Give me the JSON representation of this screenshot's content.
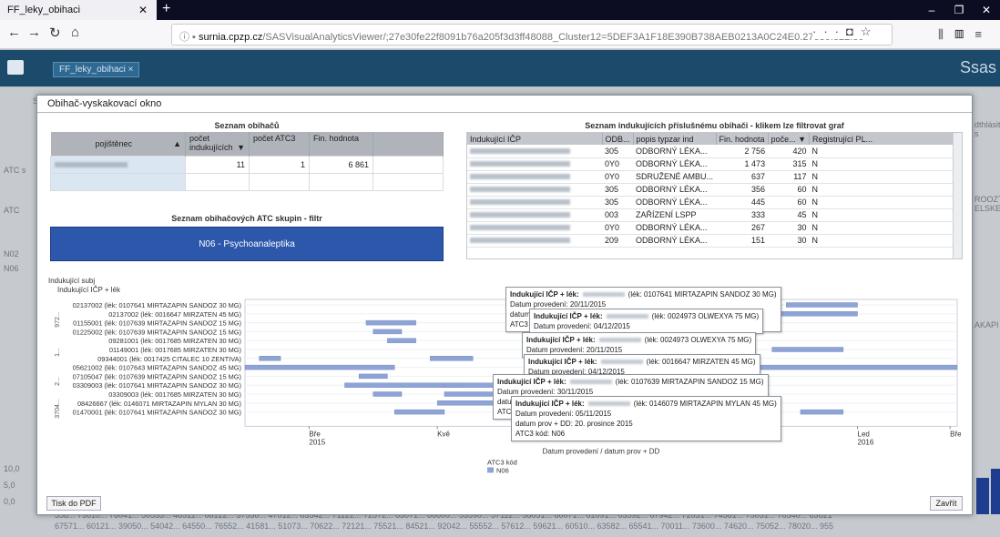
{
  "browser": {
    "tab_title": "FF_leky_obihaci",
    "url_host": "surnia.cpzp.cz",
    "url_path": "/SASVisualAnalyticsViewer/;27e30fe22f8091b76a205f3d3ff48088_Cluster12=5DEF3A1F18E390B738AEB0213A0C24E0.27e30fe22f80"
  },
  "app": {
    "tab_label": "FF_leky_obihaci",
    "logo": "Ssas"
  },
  "modal": {
    "title": "Obihač-vyskakovací okno",
    "print_label": "Tisk do PDF",
    "close_label": "Zavřít"
  },
  "obihaci": {
    "title": "Seznam obihačů",
    "col_pojistenec": "pojištěnec",
    "col_pocet_ind": "počet indukujících",
    "col_pocet_atc": "počet ATC3",
    "col_fin": "Fin. hodnota",
    "row": {
      "pocet_ind": "11",
      "pocet_atc": "1",
      "fin": "6 861"
    }
  },
  "atc": {
    "title": "Seznam obihačových ATC skupin - filtr",
    "button": "N06 - Psychoanaleptika"
  },
  "indukujici": {
    "title": "Seznam indukujících příslušnému obihači - klikem lze filtrovat graf",
    "headers": [
      "Indukující IČP",
      "ODB...",
      "popis typzar ind",
      "Fin. hodnota",
      "poče...",
      "Registrující PL..."
    ],
    "rows": [
      {
        "odb": "305",
        "popis": "ODBORNÝ LÉKA...",
        "fin": "2 756",
        "pocet": "420",
        "reg": "N"
      },
      {
        "odb": "0Y0",
        "popis": "ODBORNÝ LÉKA...",
        "fin": "1 473",
        "pocet": "315",
        "reg": "N"
      },
      {
        "odb": "0Y0",
        "popis": "SDRUŽENÉ AMBU...",
        "fin": "637",
        "pocet": "117",
        "reg": "N"
      },
      {
        "odb": "305",
        "popis": "ODBORNÝ LÉKA...",
        "fin": "356",
        "pocet": "60",
        "reg": "N"
      },
      {
        "odb": "305",
        "popis": "ODBORNÝ LÉKA...",
        "fin": "445",
        "pocet": "60",
        "reg": "N"
      },
      {
        "odb": "003",
        "popis": "ZAŘÍZENÍ LSPP",
        "fin": "333",
        "pocet": "45",
        "reg": "N"
      },
      {
        "odb": "0Y0",
        "popis": "ODBORNÝ LÉKA...",
        "fin": "267",
        "pocet": "30",
        "reg": "N"
      },
      {
        "odb": "209",
        "popis": "ODBORNÝ LÉKA...",
        "fin": "151",
        "pocet": "30",
        "reg": "N"
      }
    ]
  },
  "chart_data": {
    "type": "gantt",
    "title": "",
    "y_group_label": "Indukující subj",
    "y_label": "Indukující IČP + lék",
    "xlabel": "Datum provedení / datum prov + DD",
    "x_ticks": [
      "Bře 2015",
      "Kvě",
      "Čvc",
      "Zář",
      "Lis",
      "Led 2016",
      "Bře"
    ],
    "legend_title": "ATC3 kód",
    "legend_item": "N06",
    "color": "#8ea4d6",
    "rows": [
      "02137002 (lék: 0107641 MIRTAZAPIN SANDOZ 30 MG)",
      "02137002 (lék: 0016647 MIRZATEN 45 MG)",
      "01155001 (lék: 0107639 MIRTAZAPIN SANDOZ 15 MG)",
      "01225002 (lék: 0107639 MIRTAZAPIN SANDOZ 15 MG)",
      "09281001 (lék: 0017685 MIRZATEN 30 MG)",
      "01149001 (lék: 0017685 MIRZATEN 30 MG)",
      "09344001 (lék: 0017425 CITALEC 10 ZENTIVA)",
      "05621002 (lék: 0107643 MIRTAZAPIN SANDOZ 45 MG)",
      "07105047 (lék: 0107639 MIRTAZAPIN SANDOZ 15 MG)",
      "03309003 (lék: 0107641 MIRTAZAPIN SANDOZ 30 MG)",
      "03309003 (lék: 0017685 MIRZATEN 30 MG)",
      "08426667 (lék: 0146071 MIRTAZAPIN MYLAN 30 MG)",
      "01470001 (lék: 0107641 MIRTAZAPIN SANDOZ 30 MG)"
    ],
    "group_labels": [
      "972...",
      "1...",
      "2...",
      "3704..."
    ],
    "tooltips": [
      {
        "head": "Indukující IČP + lék:",
        "drug": "(lék: 0107641 MIRTAZAPIN SANDOZ 30 MG)",
        "line2": "Datum provedení: 20/11/2015",
        "extra": "datum",
        "extra2": "ATC3"
      },
      {
        "head": "Indukující IČP + lék:",
        "drug": "(lék: 0024973 OLWEXYA 75 MG)",
        "line2": "Datum provedení: 04/12/2015"
      },
      {
        "head": "Indukující IČP + lék:",
        "drug": "(lék: 0024973 OLWEXYA 75 MG)",
        "line2": "Datum provedení: 20/11/2015"
      },
      {
        "head": "Indukující IČP + lék:",
        "drug": "(lék: 0016647 MIRZATEN 45 MG)",
        "line2": "Datum provedení: 04/12/2015"
      },
      {
        "head": "Indukující IČP + lék:",
        "drug": "(lék: 0107639 MIRTAZAPIN SANDOZ 15 MG)",
        "line2": "Datum provedení: 30/11/2015",
        "extra": "datu",
        "extra2": "ATC"
      },
      {
        "head": "Indukující IČP + lék:",
        "drug": "(lék: 0146079 MIRTAZAPIN MYLAN 45 MG)",
        "line2": "Datum provedení: 05/11/2015",
        "line3": "datum prov + DD: 20. prosince 2015",
        "line4": "ATC3 kód: N06"
      }
    ]
  },
  "background": {
    "side_labels": [
      "Sou",
      "ATC s",
      "ATC",
      "N02",
      "N06",
      "10,0",
      "5,0",
      "0,0"
    ],
    "right_labels": [
      "dthlásit s",
      "ROOZT ELSKE",
      "AKAPI"
    ],
    "bottom_row1": "558... 73610... 76041... 50533... 48511... 68122... 37530... 47012... 63542... 71122... 72572... 63071... 86600... 53590... 57112... 58051... 60071... 61091... 63592... 67942... 72031... 74581... 75031... 76540... 83621",
    "bottom_row2": "67571... 60121... 39050... 54042... 64550... 76552... 41581... 51073... 70622... 72121... 75521... 84521... 92042... 55552... 57612... 59621... 60510... 63582... 65541... 70011... 73600... 74620... 75052... 78020... 955"
  }
}
